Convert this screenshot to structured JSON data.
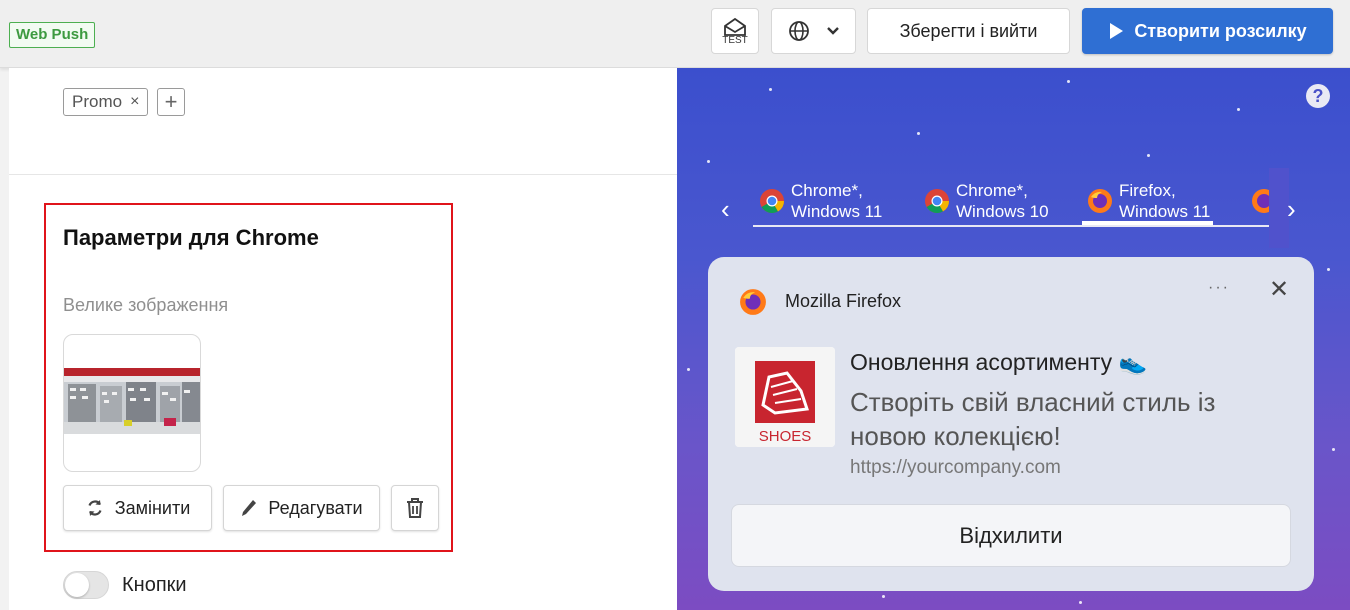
{
  "header": {
    "channel_badge": "Web Push",
    "test_label": "TEST",
    "save_exit_label": "Зберегти і вийти",
    "create_campaign_label": "Створити розсилку"
  },
  "tags": {
    "items": [
      {
        "label": "Promo"
      }
    ],
    "remove_symbol": "×",
    "add_symbol": "+"
  },
  "chrome_params": {
    "title": "Параметри для Chrome",
    "large_image_label": "Велике зображення",
    "replace_label": "Замінити",
    "edit_label": "Редагувати"
  },
  "buttons_toggle": {
    "label": "Кнопки",
    "enabled": false
  },
  "preview": {
    "help_symbol": "?",
    "tabs": [
      {
        "line1": "Chrome*,",
        "line2": "Windows 11",
        "browser": "chrome",
        "active": false
      },
      {
        "line1": "Chrome*,",
        "line2": "Windows 10",
        "browser": "chrome",
        "active": false
      },
      {
        "line1": "Firefox,",
        "line2": "Windows 11",
        "browser": "firefox",
        "active": true
      }
    ],
    "notification": {
      "app_name": "Mozilla Firefox",
      "menu_symbol": "···",
      "close_symbol": "✕",
      "thumbnail_caption": "SHOES",
      "title": "Оновлення асортименту 👟",
      "body": "Створіть свій власний стиль із новою колекцією!",
      "url": "https://yourcompany.com",
      "dismiss_label": "Відхилити"
    }
  },
  "colors": {
    "primary": "#2f6fd3",
    "highlight_border": "#e0141b",
    "badge_green": "#3d9a40",
    "preview_bg_top": "#3b4fcd",
    "preview_bg_bottom": "#7c4cc2"
  },
  "icons": [
    "test-envelope-icon",
    "globe-icon",
    "chevron-down-icon",
    "play-icon",
    "refresh-icon",
    "pencil-icon",
    "trash-icon",
    "chevron-left-icon",
    "chevron-right-icon",
    "chrome-icon",
    "firefox-icon",
    "help-icon",
    "close-icon"
  ]
}
